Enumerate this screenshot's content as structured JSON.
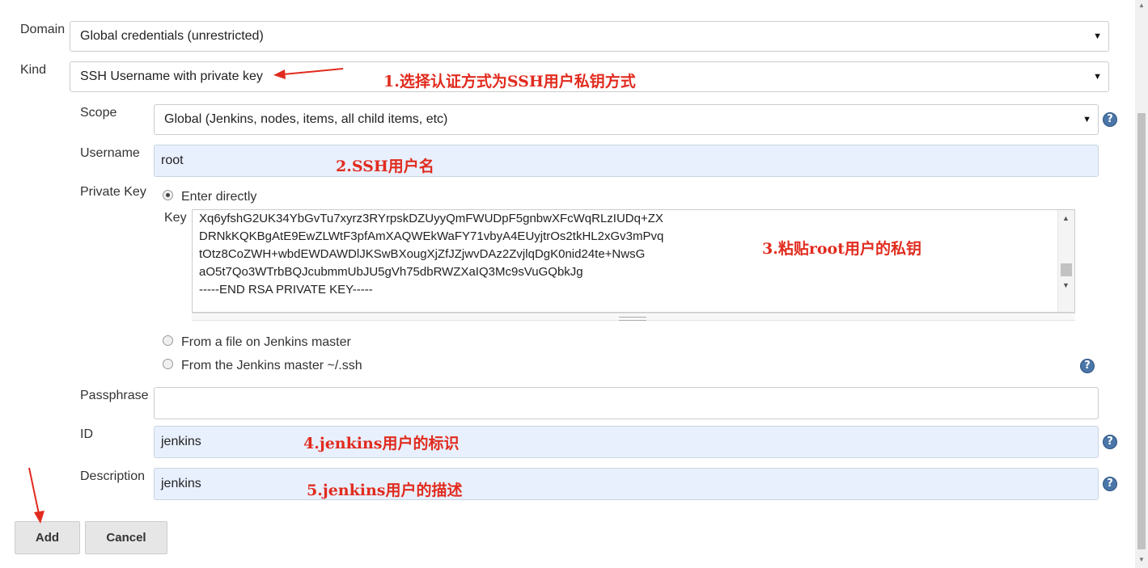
{
  "form": {
    "domain": {
      "label": "Domain",
      "value": "Global credentials (unrestricted)"
    },
    "kind": {
      "label": "Kind",
      "value": "SSH Username with private key"
    },
    "scope": {
      "label": "Scope",
      "value": "Global (Jenkins, nodes, items, all child items, etc)"
    },
    "username": {
      "label": "Username",
      "value": "root"
    },
    "private_key": {
      "label": "Private Key",
      "options": [
        "Enter directly",
        "From a file on Jenkins master",
        "From the Jenkins master ~/.ssh"
      ],
      "selected": "Enter directly",
      "key_label": "Key",
      "key_lines": [
        "Xq6yfshG2UK34YbGvTu7xyrz3RYrpskDZUyyQmFWUDpF5gnbwXFcWqRLzIUDq+ZX",
        "DRNkKQKBgAtE9EwZLWtF3pfAmXAQWEkWaFY71vbyA4EUyjtrOs2tkHL2xGv3mPvq",
        "tOtz8CoZWH+wbdEWDAWDlJKSwBXougXjZfJZjwvDAz2ZvjlqDgK0nid24te+NwsG",
        "aO5t7Qo3WTrbBQJcubmmUbJU5gVh75dbRWZXaIQ3Mc9sVuGQbkJg",
        "-----END RSA PRIVATE KEY-----"
      ]
    },
    "passphrase": {
      "label": "Passphrase",
      "value": ""
    },
    "id": {
      "label": "ID",
      "value": "jenkins"
    },
    "description": {
      "label": "Description",
      "value": "jenkins"
    },
    "buttons": {
      "add": "Add",
      "cancel": "Cancel"
    },
    "help_icon": "?"
  },
  "annotations": {
    "kind": "1.选择认证方式为SSH用户私钥方式",
    "username": "2.SSH用户名",
    "key": "3.粘贴root用户的私钥",
    "id": "4.jenkins用户的标识",
    "description": "5.jenkins用户的描述"
  },
  "colors": {
    "annotation": "#e12b1e",
    "field_fill": "#e8f0fe",
    "help": "#4a76a8"
  }
}
